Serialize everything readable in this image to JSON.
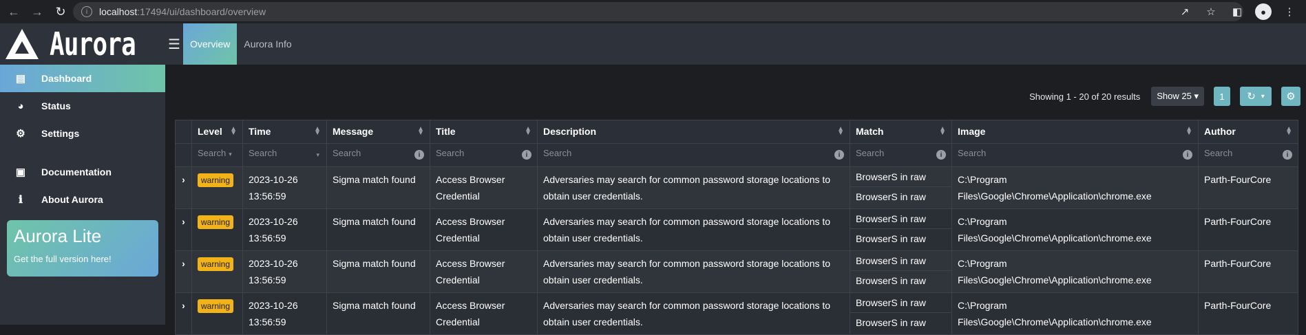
{
  "browser": {
    "url_host": "localhost",
    "url_rest": ":17494/ui/dashboard/overview"
  },
  "app": {
    "name": "Aurora",
    "accent_start": "#6aa7d8",
    "accent_end": "#6fc4a8",
    "tabs": [
      {
        "label": "Overview",
        "active": true
      },
      {
        "label": "Aurora Info",
        "active": false
      }
    ]
  },
  "sidebar": {
    "items": [
      {
        "label": "Dashboard",
        "icon": "chart-icon",
        "active": true
      },
      {
        "label": "Status",
        "icon": "gauge-icon"
      },
      {
        "label": "Settings",
        "icon": "gear-icon"
      },
      {
        "label": "Documentation",
        "icon": "book-icon"
      },
      {
        "label": "About Aurora",
        "icon": "info-icon"
      }
    ],
    "promo": {
      "title": "Aurora Lite",
      "subtitle": "Get the full version here!"
    }
  },
  "toolbar": {
    "results_text": "Showing 1 - 20 of 20 results",
    "show_label": "Show 25",
    "page": "1"
  },
  "table": {
    "columns": [
      "Level",
      "Time",
      "Message",
      "Title",
      "Description",
      "Match",
      "Image",
      "Author"
    ],
    "filter_placeholder": "Search",
    "rows": [
      {
        "level": "warning",
        "time": "2023-10-26 13:56:59",
        "message": "Sigma match found",
        "title": "Access Browser Credential",
        "description": "Adversaries may search for common password storage locations to obtain user credentials.",
        "match": [
          "BrowserS in raw",
          "BrowserS in raw"
        ],
        "image": "C:\\Program Files\\Google\\Chrome\\Application\\chrome.exe",
        "author": "Parth-FourCore"
      },
      {
        "level": "warning",
        "time": "2023-10-26 13:56:59",
        "message": "Sigma match found",
        "title": "Access Browser Credential",
        "description": "Adversaries may search for common password storage locations to obtain user credentials.",
        "match": [
          "BrowserS in raw",
          "BrowserS in raw"
        ],
        "image": "C:\\Program Files\\Google\\Chrome\\Application\\chrome.exe",
        "author": "Parth-FourCore"
      },
      {
        "level": "warning",
        "time": "2023-10-26 13:56:59",
        "message": "Sigma match found",
        "title": "Access Browser Credential",
        "description": "Adversaries may search for common password storage locations to obtain user credentials.",
        "match": [
          "BrowserS in raw",
          "BrowserS in raw"
        ],
        "image": "C:\\Program Files\\Google\\Chrome\\Application\\chrome.exe",
        "author": "Parth-FourCore"
      },
      {
        "level": "warning",
        "time": "2023-10-26 13:56:59",
        "message": "Sigma match found",
        "title": "Access Browser Credential",
        "description": "Adversaries may search for common password storage locations to obtain user credentials.",
        "match": [
          "BrowserS in raw",
          "BrowserS in raw"
        ],
        "image": "C:\\Program Files\\Google\\Chrome\\Application\\chrome.exe",
        "author": "Parth-FourCore"
      }
    ]
  }
}
